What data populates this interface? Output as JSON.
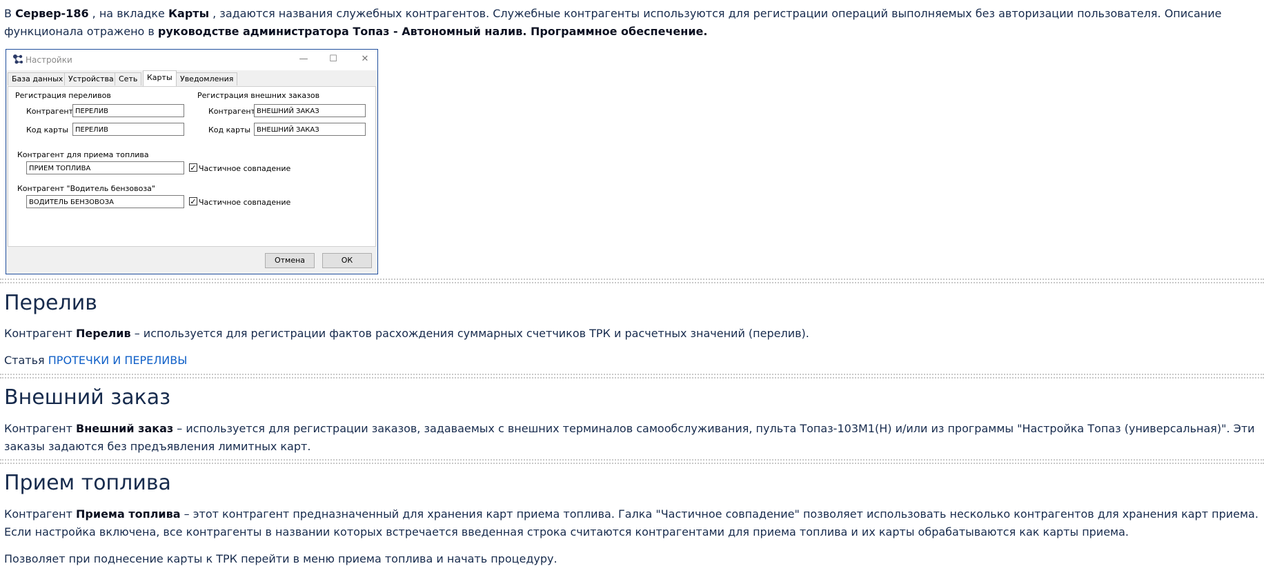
{
  "intro": {
    "p1": "В ",
    "server": "Сервер-186",
    "p2": " , на вкладке ",
    "tab": "Карты",
    "p3": " , задаются названия служебных контрагентов. Служебные контрагенты используются для регистрации операций выполняемых без авторизации пользователя. Описание функционала отражено в ",
    "manual": "руководстве администратора Топаз - Автономный налив. Программное обеспечение."
  },
  "dialog": {
    "title": "Настройки",
    "window_controls": [
      "—",
      "☐",
      "✕"
    ],
    "tabs": [
      {
        "label": "База данных",
        "active": false
      },
      {
        "label": "Устройства",
        "active": false
      },
      {
        "label": "Сеть",
        "active": false
      },
      {
        "label": "Карты",
        "active": true
      },
      {
        "label": "Уведомления",
        "active": false
      }
    ],
    "overflow_reg": {
      "title": "Регистрация переливов",
      "counterparty_label": "Контрагент",
      "counterparty_value": "ПЕРЕЛИВ",
      "card_label": "Код карты",
      "card_value": "ПЕРЕЛИВ"
    },
    "ext_orders": {
      "title": "Регистрация внешних заказов",
      "counterparty_label": "Контрагент",
      "counterparty_value": "ВНЕШНИЙ ЗАКАЗ",
      "card_label": "Код карты",
      "card_value": "ВНЕШНИЙ ЗАКАЗ"
    },
    "fuel_receipt": {
      "title": "Контрагент для приема топлива",
      "value": "ПРИЕМ ТОПЛИВА",
      "partial_label": "Частичное совпадение",
      "partial_checked": true
    },
    "driver": {
      "title": "Контрагент \"Водитель бензовоза\"",
      "value": "ВОДИТЕЛЬ БЕНЗОВОЗА",
      "partial_label": "Частичное совпадение",
      "partial_checked": true
    },
    "cancel_label": "Отмена",
    "ok_label": "ОК",
    "check_glyph": "✓"
  },
  "section_overflow": {
    "heading": "Перелив",
    "p1": "Контрагент ",
    "term": "Перелив",
    "p2": " – используется для регистрации фактов расхождения суммарных счетчиков ТРК и расчетных значений (перелив).",
    "article_label": "Статья ",
    "article_link": "ПРОТЕЧКИ И ПЕРЕЛИВЫ"
  },
  "section_external": {
    "heading": "Внешний заказ",
    "p1": "Контрагент ",
    "term": "Внешний заказ",
    "p2": " – используется для регистрации заказов, задаваемых с внешних терминалов самообслуживания, пульта Топаз-103М1(Н) и/или из программы \"Настройка Топаз (универсальная)\". Эти заказы задаются без предъявления лимитных карт."
  },
  "section_receipt": {
    "heading": "Прием топлива",
    "p1": "Контрагент ",
    "term": "Приема топлива",
    "p2": " – этот контрагент предназначенный для хранения карт приема топлива. Галка \"Частичное совпадение\" позволяет использовать несколько контрагентов для хранения карт приема. Если настройка включена, все контрагенты в названии которых встречается введенная строка считаются контрагентами для приема топлива и их карты обрабатываются как карты приема.",
    "p3": "Позволяет при поднесение карты к ТРК перейти в меню приема топлива и начать процедуру."
  }
}
